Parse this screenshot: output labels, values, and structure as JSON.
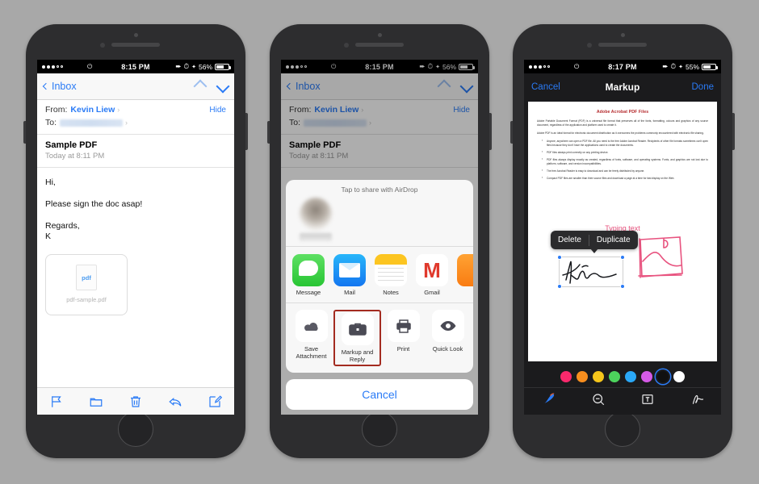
{
  "phone1": {
    "status": {
      "time": "8:15 PM",
      "battery": "56%",
      "carrier_dots": 5,
      "wifi_icon": "wifi-icon"
    },
    "nav": {
      "back_label": "Inbox",
      "up_icon": "chevron-up-icon",
      "down_icon": "chevron-down-icon"
    },
    "header": {
      "from_label": "From:",
      "from_name": "Kevin Liew",
      "to_label": "To:",
      "to_value": "",
      "hide_label": "Hide"
    },
    "message": {
      "subject": "Sample PDF",
      "date": "Today at 8:11 PM",
      "greeting": "Hi,",
      "body": "Please sign the doc asap!",
      "signoff": "Regards,",
      "signature": "K",
      "attachment": {
        "type_label": "pdf",
        "filename": "pdf-sample.pdf"
      }
    },
    "toolbar": [
      {
        "name": "flag-icon",
        "label": "Flag"
      },
      {
        "name": "folder-icon",
        "label": "Move"
      },
      {
        "name": "trash-icon",
        "label": "Delete"
      },
      {
        "name": "reply-icon",
        "label": "Reply"
      },
      {
        "name": "compose-icon",
        "label": "Compose"
      }
    ]
  },
  "phone2": {
    "status": {
      "time": "8:15 PM",
      "battery": "56%"
    },
    "nav": {
      "back_label": "Inbox"
    },
    "header": {
      "from_label": "From:",
      "from_name": "Kevin Liew",
      "to_label": "To:",
      "hide_label": "Hide"
    },
    "message": {
      "subject": "Sample PDF",
      "date": "Today at 8:11 PM"
    },
    "share_sheet": {
      "airdrop_title": "Tap to share with AirDrop",
      "apps": [
        {
          "label": "Message",
          "icon": "messages-app-icon"
        },
        {
          "label": "Mail",
          "icon": "mail-app-icon"
        },
        {
          "label": "Notes",
          "icon": "notes-app-icon"
        },
        {
          "label": "Gmail",
          "icon": "gmail-app-icon",
          "glyph": "M"
        },
        {
          "label": "",
          "icon": "more-app-icon"
        }
      ],
      "actions": [
        {
          "label": "Save Attachment",
          "icon": "cloud-download-icon",
          "highlighted": false
        },
        {
          "label": "Markup and Reply",
          "icon": "briefcase-icon",
          "highlighted": true
        },
        {
          "label": "Print",
          "icon": "printer-icon",
          "highlighted": false
        },
        {
          "label": "Quick Look",
          "icon": "eye-icon",
          "highlighted": false
        }
      ],
      "cancel_label": "Cancel",
      "highlight_color": "#a32b20"
    }
  },
  "phone3": {
    "status": {
      "time": "8:17 PM",
      "battery": "55%"
    },
    "nav": {
      "cancel_label": "Cancel",
      "title": "Markup",
      "done_label": "Done"
    },
    "document": {
      "title": "Adobe Acrobat PDF Files",
      "paragraphs": [
        "Adobe Portable Document Format (PDF) is a universal file format that preserves all of the fonts, formatting, colours and graphics of any source document, regardless of the application and platform used to create it.",
        "Adobe PDF is an ideal format for electronic document distribution as it overcomes the problems commonly encountered with electronic file sharing."
      ],
      "bullets": [
        "Anyone, anywhere can open a PDF file. All you need is the free Adobe Acrobat Reader. Recipients of other file formats sometimes can't open files because they don't have the applications used to create the documents.",
        "PDF files always print correctly on any printing device.",
        "PDF files always display exactly as created, regardless of fonts, software, and operating systems. Fonts, and graphics are not lost due to platform, software, and version incompatibilities.",
        "The free Acrobat Reader is easy to download and can be freely distributed by anyone.",
        "Compact PDF files are smaller than their source files and download a page at a time for fast display on the Web."
      ]
    },
    "annotations": {
      "typing_text": "Typing text",
      "typing_color": "#e8537f",
      "signature_alt": "Kevin handwritten signature",
      "sketch_alt": "pink hand drawn sketch",
      "context_menu": {
        "delete_label": "Delete",
        "duplicate_label": "Duplicate"
      }
    },
    "palette": [
      {
        "name": "pink",
        "hex": "#f9296c",
        "selected": false
      },
      {
        "name": "orange",
        "hex": "#f78e1e",
        "selected": false
      },
      {
        "name": "yellow",
        "hex": "#f5c51b",
        "selected": false
      },
      {
        "name": "green",
        "hex": "#4cd35c",
        "selected": false
      },
      {
        "name": "blue",
        "hex": "#2aa8f7",
        "selected": false
      },
      {
        "name": "magenta",
        "hex": "#d55ae6",
        "selected": false
      },
      {
        "name": "black",
        "hex": "#111111",
        "selected": true
      },
      {
        "name": "white",
        "hex": "#ffffff",
        "selected": false
      }
    ],
    "tools": [
      {
        "name": "pen-tool-icon",
        "label": "Pen",
        "selected": true
      },
      {
        "name": "magnifier-tool-icon",
        "label": "Zoom",
        "selected": false
      },
      {
        "name": "text-tool-icon",
        "label": "Text",
        "selected": false
      },
      {
        "name": "signature-tool-icon",
        "label": "Signature",
        "selected": false
      }
    ]
  }
}
